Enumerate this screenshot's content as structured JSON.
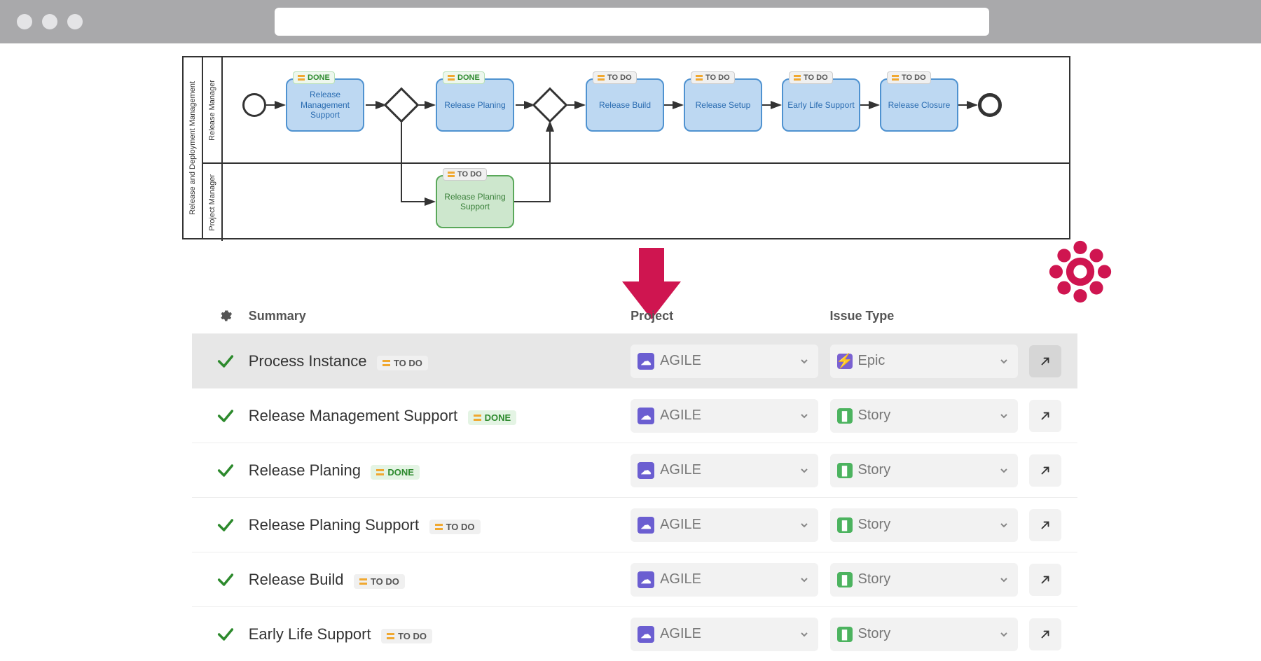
{
  "bpmn": {
    "pool_label": "Release and Deployment Management",
    "lane1_label": "Release Manager",
    "lane2_label": "Project Manager",
    "tasks": [
      {
        "name": "Release Management Support",
        "status": "DONE"
      },
      {
        "name": "Release Planing",
        "status": "DONE"
      },
      {
        "name": "Release Build",
        "status": "TO DO"
      },
      {
        "name": "Release Setup",
        "status": "TO DO"
      },
      {
        "name": "Early Life Support",
        "status": "TO DO"
      },
      {
        "name": "Release Closure",
        "status": "TO DO"
      },
      {
        "name": "Release Planing Support",
        "status": "TO DO",
        "lane": 2
      }
    ]
  },
  "table": {
    "headers": {
      "summary": "Summary",
      "project": "Project",
      "issue_type": "Issue Type"
    },
    "rows": [
      {
        "summary": "Process Instance",
        "status": "TO DO",
        "project": "AGILE",
        "issue_type": "Epic",
        "highlight": true
      },
      {
        "summary": "Release Management Support",
        "status": "DONE",
        "project": "AGILE",
        "issue_type": "Story"
      },
      {
        "summary": "Release Planing",
        "status": "DONE",
        "project": "AGILE",
        "issue_type": "Story"
      },
      {
        "summary": "Release Planing Support",
        "status": "TO DO",
        "project": "AGILE",
        "issue_type": "Story"
      },
      {
        "summary": "Release Build",
        "status": "TO DO",
        "project": "AGILE",
        "issue_type": "Story"
      },
      {
        "summary": "Early Life Support",
        "status": "TO DO",
        "project": "AGILE",
        "issue_type": "Story"
      }
    ]
  },
  "colors": {
    "accent_red": "#cf1550",
    "accent_gear": "#cf1550"
  }
}
